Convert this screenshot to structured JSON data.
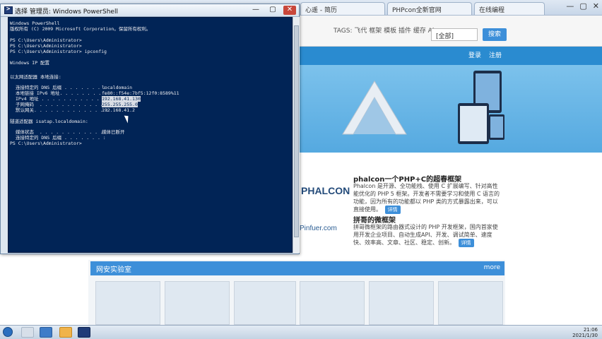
{
  "browser": {
    "tabs": [
      "心遥 - 简历",
      "PHPcon全新官网",
      "在线编程"
    ],
    "controls": {
      "minimize": "—",
      "maximize": "▢",
      "close": "✕"
    },
    "tags_text": "TAGS: 飞代 框架 模板 插件 缓存 Ajax",
    "category": "[全部]",
    "search_button": "搜索",
    "login": "登录",
    "register": "注册"
  },
  "features": {
    "logo1": "PHALCON",
    "logo2": "Pinfuer.com",
    "item1_title": "phalcon一个PHP+C的超春框架",
    "item1_desc": "Phalcon 是开源、全功能栈、使用 C 扩展编写、针对高性能优化的 PHP 5 框架。开发者不需要学习和使用 C 语言的功能，因为所有的功能都以 PHP 类的方式暴露出来，可以直接使用。",
    "item2_title": "拼哥的微框架",
    "item2_desc": "拼哥微框架的路由器式设计的 PHP 开发框架，国内首家使用开发企业项目、自动生成API、开发、调试简单、速度快、效率高、文章、社区、稳定、创新。",
    "more_label": "详情",
    "lab_header": "网安实验室",
    "lab_more": "more"
  },
  "powershell": {
    "title": "选择 管理员: Windows PowerShell",
    "minimize": "—",
    "maximize": "▢",
    "close": "✕",
    "lines": [
      "Windows PowerShell",
      "版权所有 (C) 2009 Microsoft Corporation。保留所有权利。",
      "",
      "PS C:\\Users\\Administrator>",
      "PS C:\\Users\\Administrator>",
      "PS C:\\Users\\Administrator> ipconfig",
      "",
      "Windows IP 配置",
      "",
      "",
      "以太网适配器 本地连接:",
      ""
    ],
    "adapter1": [
      {
        "key": "连接特定的 DNS 后缀 . . . . . . . :",
        "value": "localdomain"
      },
      {
        "key": "本地链接 IPv6 地址. . . . . . . . :",
        "value": "fe80::f54e:7bf5:12f0:8589%11"
      },
      {
        "key": "IPv4 地址 . . . . . . . . . . . . :",
        "value": "192.168.41.130"
      },
      {
        "key": "子网掩码  . . . . . . . . . . . . :",
        "value": "255.255.255.0"
      },
      {
        "key": "默认网关. . . . . . . . . . . . . :",
        "value": "192.168.41.2"
      }
    ],
    "adapter2_title": "隧道适配器 isatap.localdomain:",
    "adapter2": [
      {
        "key": "媒体状态  . . . . . . . . . . . . :",
        "value": "媒体已断开"
      },
      {
        "key": "连接特定的 DNS 后缀 . . . . . . . :",
        "value": ""
      }
    ],
    "final_prompt": "PS C:\\Users\\Administrator>"
  },
  "taskbar": {
    "time": "21:06",
    "date": "2021/1/30"
  }
}
